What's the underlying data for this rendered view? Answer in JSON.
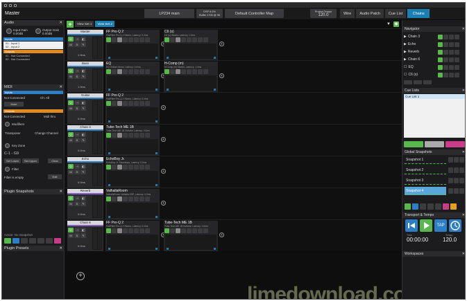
{
  "top": {
    "master": "Master",
    "song": "LP234 main",
    "dsp_line1": "DSP 8.0%",
    "dsp_line2": "Buffer 1728 @ 96",
    "controller_map": "Default Controller Map",
    "tempo_label": "Project Tempo",
    "tempo": "120.0",
    "wire": "Wire",
    "audio_patch": "Audio Patch",
    "cue_list": "Cue List",
    "chains": "Chains"
  },
  "left": {
    "audio": "Audio",
    "input_gain": "Input Gain",
    "input_gain_val": "0.00dB",
    "output_gain": "Output Gain",
    "output_gain_val": "0.00dB",
    "inputs": "Inputs",
    "input1": "01 - Input 1",
    "input2": "02 - Input 2",
    "outputs": "Outputs",
    "output1": "01 - Not Connected",
    "output2": "02 - Not Connected",
    "midi": "MIDI",
    "midi_inputs": "Inputs",
    "not_connected": "Not Connected",
    "ch_all": "Ch: All",
    "mute": "Mute",
    "midi_outputs": "Outputs",
    "not_connected2": "Not Connected",
    "midi_thru": "Midi thru",
    "modifiers": "Modifiers",
    "transposer": "Transposer",
    "change_channel": "Change Channel",
    "key_zone": "Key Zone",
    "range": "C-1 - G9",
    "set_lower": "Set Lower",
    "set_upper": "Set Upper",
    "clear": "Clear",
    "filter": "Filter",
    "filter_empty": "Filter is empty",
    "edit": "Edit",
    "plugin_snapshots": "Plugin Snapshots",
    "active": "Active: No Snapshot",
    "plugin_presets": "Plugin Presets"
  },
  "center": {
    "set1": "View Set 1",
    "set2": "View Set 2",
    "chains": [
      {
        "name": "Master",
        "vol": "1.9ms",
        "plugins": [
          {
            "name": "FF Pro-Q 2",
            "info": "FabFilter Pro-Q 2 Stereo, Latency: 0.0ms"
          },
          {
            "name": "C6 (s)",
            "info": "C6 (s) Waves, Latency: 1.0ms"
          }
        ]
      },
      {
        "name": "Bass",
        "vol": "1.9ms",
        "plugins": [
          {
            "name": "EQ",
            "info": "EQ Tedium Mono, Latency: 0.0ms"
          },
          {
            "name": "H-Comp (m)",
            "info": "H-Comp (m) Waves, Latency: 1.0ms"
          }
        ]
      },
      {
        "name": "Guitar",
        "vol": "0.0ms",
        "plugins": [
          {
            "name": "FF Pro-Q 2",
            "info": "FabFilter Pro-Q 2 Stereo, Latency: 0.0ms"
          }
        ]
      },
      {
        "name": "Chain 3",
        "vol": "0.0ms",
        "plugins": [
          {
            "name": "Tube-Tech ME 1B",
            "info": "Tube-Tech ME 1B Softube, Latency: 0.0ms"
          }
        ]
      },
      {
        "name": "Echo",
        "vol": "0.0ms",
        "plugins": [
          {
            "name": "EchoBoy Jr.",
            "info": "EchoBoy Jr. Soundtoys, Latency: 0.0ms"
          }
        ]
      },
      {
        "name": "Reverb",
        "vol": "0.0ms",
        "plugins": [
          {
            "name": "ValhallaRoom",
            "info": "ValhallaRoom Valhalla DSP, Latency: 0.0ms"
          }
        ]
      },
      {
        "name": "Chain 6",
        "vol": "0.0ms",
        "plugins": [
          {
            "name": "FF Pro-Q 2",
            "info": "FabFilter Pro-Q 2 Stereo, Latency: 0.0ms"
          },
          {
            "name": "Tube-Tech ME 1B",
            "info": "Tube-Tech ME 1B Softube, Latency: 0.0ms"
          }
        ]
      }
    ]
  },
  "right": {
    "navigator": "Navigator",
    "nav_items": [
      "Chain 3",
      "Echo",
      "Reverb",
      "Chain 6",
      "EQ",
      "C6 (s)"
    ],
    "cue_lists": "Cue Lists",
    "cue_item": "Cue List 1",
    "global_snapshots": "Global Snapshots",
    "snapshots": [
      "Snapshot 1",
      "Snapshot 2",
      "Snapshot 3",
      "Snapshot 4"
    ],
    "transport": "Transport & Tempo",
    "tap": "TAP",
    "time_label": "Time",
    "time": "00:00:00",
    "tempo_label": "Tempo",
    "tempo": "120.0",
    "workspaces": "Workspaces"
  },
  "watermark": "limedownload.com"
}
